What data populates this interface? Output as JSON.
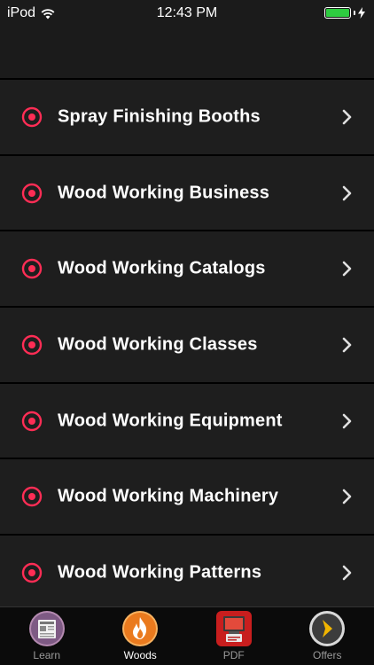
{
  "status_bar": {
    "carrier": "iPod",
    "time": "12:43 PM"
  },
  "list": {
    "items": [
      {
        "label": "Spray Finishing Booths"
      },
      {
        "label": "Wood Working Business"
      },
      {
        "label": "Wood Working Catalogs"
      },
      {
        "label": "Wood Working Classes"
      },
      {
        "label": "Wood Working Equipment"
      },
      {
        "label": "Wood Working Machinery"
      },
      {
        "label": "Wood Working Patterns"
      }
    ],
    "icon_color": "#ff2d55"
  },
  "tab_bar": {
    "tabs": [
      {
        "label": "Learn",
        "icon": "newspaper-icon"
      },
      {
        "label": "Woods",
        "icon": "flame-icon",
        "active": true
      },
      {
        "label": "PDF",
        "icon": "pdf-icon"
      },
      {
        "label": "Offers",
        "icon": "chevron-circle-icon"
      }
    ]
  }
}
